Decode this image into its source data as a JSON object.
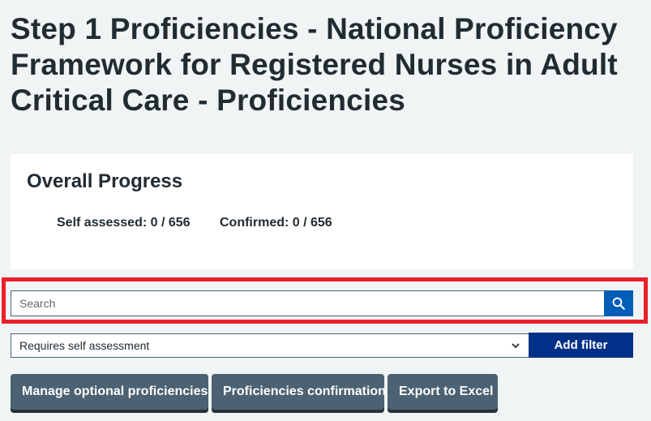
{
  "page": {
    "title": "Step 1 Proficiencies - National Proficiency Framework for Registered Nurses in Adult Critical Care - Proficiencies"
  },
  "progress": {
    "heading": "Overall Progress",
    "self_assessed": "Self assessed: 0 / 656",
    "confirmed": "Confirmed: 0 / 656"
  },
  "search": {
    "placeholder": "Search",
    "value": "",
    "button_icon": "search-icon"
  },
  "filter": {
    "selected": "Requires self assessment",
    "add_label": "Add filter"
  },
  "actions": {
    "manage_label": "Manage optional proficiencies",
    "confirmation_label": "Proficiencies confirmation",
    "export_label": "Export to Excel"
  },
  "colors": {
    "background": "#f0f4f5",
    "highlight": "#e8202a",
    "primary_blue": "#005eb8",
    "dark_blue": "#003087",
    "secondary_button": "#4c6272"
  }
}
